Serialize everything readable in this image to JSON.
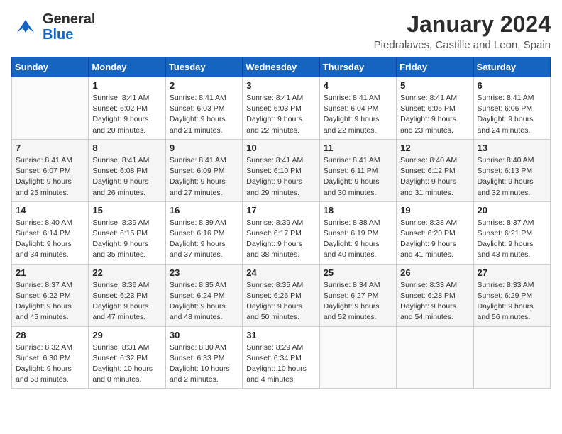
{
  "header": {
    "logo_general": "General",
    "logo_blue": "Blue",
    "month_title": "January 2024",
    "location": "Piedralaves, Castille and Leon, Spain"
  },
  "weekdays": [
    "Sunday",
    "Monday",
    "Tuesday",
    "Wednesday",
    "Thursday",
    "Friday",
    "Saturday"
  ],
  "weeks": [
    [
      {
        "day": "",
        "info": ""
      },
      {
        "day": "1",
        "info": "Sunrise: 8:41 AM\nSunset: 6:02 PM\nDaylight: 9 hours\nand 20 minutes."
      },
      {
        "day": "2",
        "info": "Sunrise: 8:41 AM\nSunset: 6:03 PM\nDaylight: 9 hours\nand 21 minutes."
      },
      {
        "day": "3",
        "info": "Sunrise: 8:41 AM\nSunset: 6:03 PM\nDaylight: 9 hours\nand 22 minutes."
      },
      {
        "day": "4",
        "info": "Sunrise: 8:41 AM\nSunset: 6:04 PM\nDaylight: 9 hours\nand 22 minutes."
      },
      {
        "day": "5",
        "info": "Sunrise: 8:41 AM\nSunset: 6:05 PM\nDaylight: 9 hours\nand 23 minutes."
      },
      {
        "day": "6",
        "info": "Sunrise: 8:41 AM\nSunset: 6:06 PM\nDaylight: 9 hours\nand 24 minutes."
      }
    ],
    [
      {
        "day": "7",
        "info": "Sunrise: 8:41 AM\nSunset: 6:07 PM\nDaylight: 9 hours\nand 25 minutes."
      },
      {
        "day": "8",
        "info": "Sunrise: 8:41 AM\nSunset: 6:08 PM\nDaylight: 9 hours\nand 26 minutes."
      },
      {
        "day": "9",
        "info": "Sunrise: 8:41 AM\nSunset: 6:09 PM\nDaylight: 9 hours\nand 27 minutes."
      },
      {
        "day": "10",
        "info": "Sunrise: 8:41 AM\nSunset: 6:10 PM\nDaylight: 9 hours\nand 29 minutes."
      },
      {
        "day": "11",
        "info": "Sunrise: 8:41 AM\nSunset: 6:11 PM\nDaylight: 9 hours\nand 30 minutes."
      },
      {
        "day": "12",
        "info": "Sunrise: 8:40 AM\nSunset: 6:12 PM\nDaylight: 9 hours\nand 31 minutes."
      },
      {
        "day": "13",
        "info": "Sunrise: 8:40 AM\nSunset: 6:13 PM\nDaylight: 9 hours\nand 32 minutes."
      }
    ],
    [
      {
        "day": "14",
        "info": "Sunrise: 8:40 AM\nSunset: 6:14 PM\nDaylight: 9 hours\nand 34 minutes."
      },
      {
        "day": "15",
        "info": "Sunrise: 8:39 AM\nSunset: 6:15 PM\nDaylight: 9 hours\nand 35 minutes."
      },
      {
        "day": "16",
        "info": "Sunrise: 8:39 AM\nSunset: 6:16 PM\nDaylight: 9 hours\nand 37 minutes."
      },
      {
        "day": "17",
        "info": "Sunrise: 8:39 AM\nSunset: 6:17 PM\nDaylight: 9 hours\nand 38 minutes."
      },
      {
        "day": "18",
        "info": "Sunrise: 8:38 AM\nSunset: 6:19 PM\nDaylight: 9 hours\nand 40 minutes."
      },
      {
        "day": "19",
        "info": "Sunrise: 8:38 AM\nSunset: 6:20 PM\nDaylight: 9 hours\nand 41 minutes."
      },
      {
        "day": "20",
        "info": "Sunrise: 8:37 AM\nSunset: 6:21 PM\nDaylight: 9 hours\nand 43 minutes."
      }
    ],
    [
      {
        "day": "21",
        "info": "Sunrise: 8:37 AM\nSunset: 6:22 PM\nDaylight: 9 hours\nand 45 minutes."
      },
      {
        "day": "22",
        "info": "Sunrise: 8:36 AM\nSunset: 6:23 PM\nDaylight: 9 hours\nand 47 minutes."
      },
      {
        "day": "23",
        "info": "Sunrise: 8:35 AM\nSunset: 6:24 PM\nDaylight: 9 hours\nand 48 minutes."
      },
      {
        "day": "24",
        "info": "Sunrise: 8:35 AM\nSunset: 6:26 PM\nDaylight: 9 hours\nand 50 minutes."
      },
      {
        "day": "25",
        "info": "Sunrise: 8:34 AM\nSunset: 6:27 PM\nDaylight: 9 hours\nand 52 minutes."
      },
      {
        "day": "26",
        "info": "Sunrise: 8:33 AM\nSunset: 6:28 PM\nDaylight: 9 hours\nand 54 minutes."
      },
      {
        "day": "27",
        "info": "Sunrise: 8:33 AM\nSunset: 6:29 PM\nDaylight: 9 hours\nand 56 minutes."
      }
    ],
    [
      {
        "day": "28",
        "info": "Sunrise: 8:32 AM\nSunset: 6:30 PM\nDaylight: 9 hours\nand 58 minutes."
      },
      {
        "day": "29",
        "info": "Sunrise: 8:31 AM\nSunset: 6:32 PM\nDaylight: 10 hours\nand 0 minutes."
      },
      {
        "day": "30",
        "info": "Sunrise: 8:30 AM\nSunset: 6:33 PM\nDaylight: 10 hours\nand 2 minutes."
      },
      {
        "day": "31",
        "info": "Sunrise: 8:29 AM\nSunset: 6:34 PM\nDaylight: 10 hours\nand 4 minutes."
      },
      {
        "day": "",
        "info": ""
      },
      {
        "day": "",
        "info": ""
      },
      {
        "day": "",
        "info": ""
      }
    ]
  ]
}
